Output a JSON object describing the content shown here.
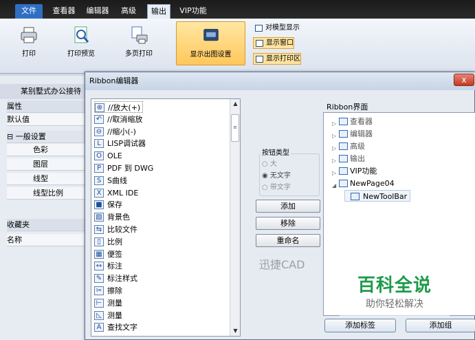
{
  "menu_tabs": [
    "文件",
    "查看器",
    "编辑器",
    "高级",
    "输出",
    "VIP功能"
  ],
  "ribbon": {
    "print": "打印",
    "print_preview": "打印预览",
    "multipage_print": "多页打印",
    "show_output_settings": "显示出图设置",
    "model_display": "对模型显示",
    "display_window": "显示窗口",
    "display_print_area": "显示打印区"
  },
  "left_panel": {
    "title": "某别墅式办公接待",
    "properties_header": "属性",
    "default_value": "默认值",
    "general_settings": "⊟ 一般设置",
    "rows": [
      "色彩",
      "图层",
      "线型",
      "线型比例"
    ],
    "favorites": "收藏夹",
    "name": "名称"
  },
  "dialog": {
    "title": "Ribbon编辑器",
    "close": "x",
    "commands": [
      {
        "icon": "zoom-in-icon",
        "glyph": "⊕",
        "label": "//放大(+)"
      },
      {
        "icon": "undo-zoom-icon",
        "glyph": "↶",
        "label": "//取消缩放"
      },
      {
        "icon": "zoom-out-icon",
        "glyph": "⊖",
        "label": "//缩小(-)"
      },
      {
        "icon": "lisp-debug-icon",
        "glyph": "L",
        "label": "LISP调试器"
      },
      {
        "icon": "ole-icon",
        "glyph": "O",
        "label": "OLE"
      },
      {
        "icon": "pdf-to-dwg-icon",
        "glyph": "P",
        "label": "PDF 到 DWG"
      },
      {
        "icon": "s-curve-icon",
        "glyph": "S",
        "label": "S曲线"
      },
      {
        "icon": "xml-ide-icon",
        "glyph": "X",
        "label": "XML IDE"
      },
      {
        "icon": "save-icon",
        "glyph": "■",
        "label": "保存"
      },
      {
        "icon": "background-color-icon",
        "glyph": "▨",
        "label": "背景色"
      },
      {
        "icon": "compare-files-icon",
        "glyph": "⇆",
        "label": "比较文件"
      },
      {
        "icon": "scale-icon",
        "glyph": "▯",
        "label": "比例"
      },
      {
        "icon": "sticky-note-icon",
        "glyph": "▦",
        "label": "便签"
      },
      {
        "icon": "dimension-icon",
        "glyph": "↔",
        "label": "标注"
      },
      {
        "icon": "dimension-style-icon",
        "glyph": "✎",
        "label": "标注样式"
      },
      {
        "icon": "erase-icon",
        "glyph": "✂",
        "label": "擦除"
      },
      {
        "icon": "measure-icon",
        "glyph": "⊢",
        "label": "测量"
      },
      {
        "icon": "measure-angle-icon",
        "glyph": "◺",
        "label": "测量"
      },
      {
        "icon": "find-text-icon",
        "glyph": "A",
        "label": "查找文字"
      }
    ],
    "button_type": {
      "title": "按钮类型",
      "large": "大",
      "no_text": "无文字",
      "with_text": "带文字",
      "selected": "无文字"
    },
    "actions": {
      "add": "添加",
      "remove": "移除",
      "rename": "重命名"
    },
    "brand": "迅捷CAD",
    "ribbon_interface_label": "Ribbon界面",
    "tree": [
      "查看器",
      "编辑器",
      "高级",
      "输出",
      "VIP功能",
      "NewPage04",
      "NewToolBar"
    ],
    "add_tab_button": "添加标签",
    "add_group_button": "添加组"
  },
  "watermark": {
    "line1": "百科全说",
    "line2": "助你轻松解决"
  }
}
